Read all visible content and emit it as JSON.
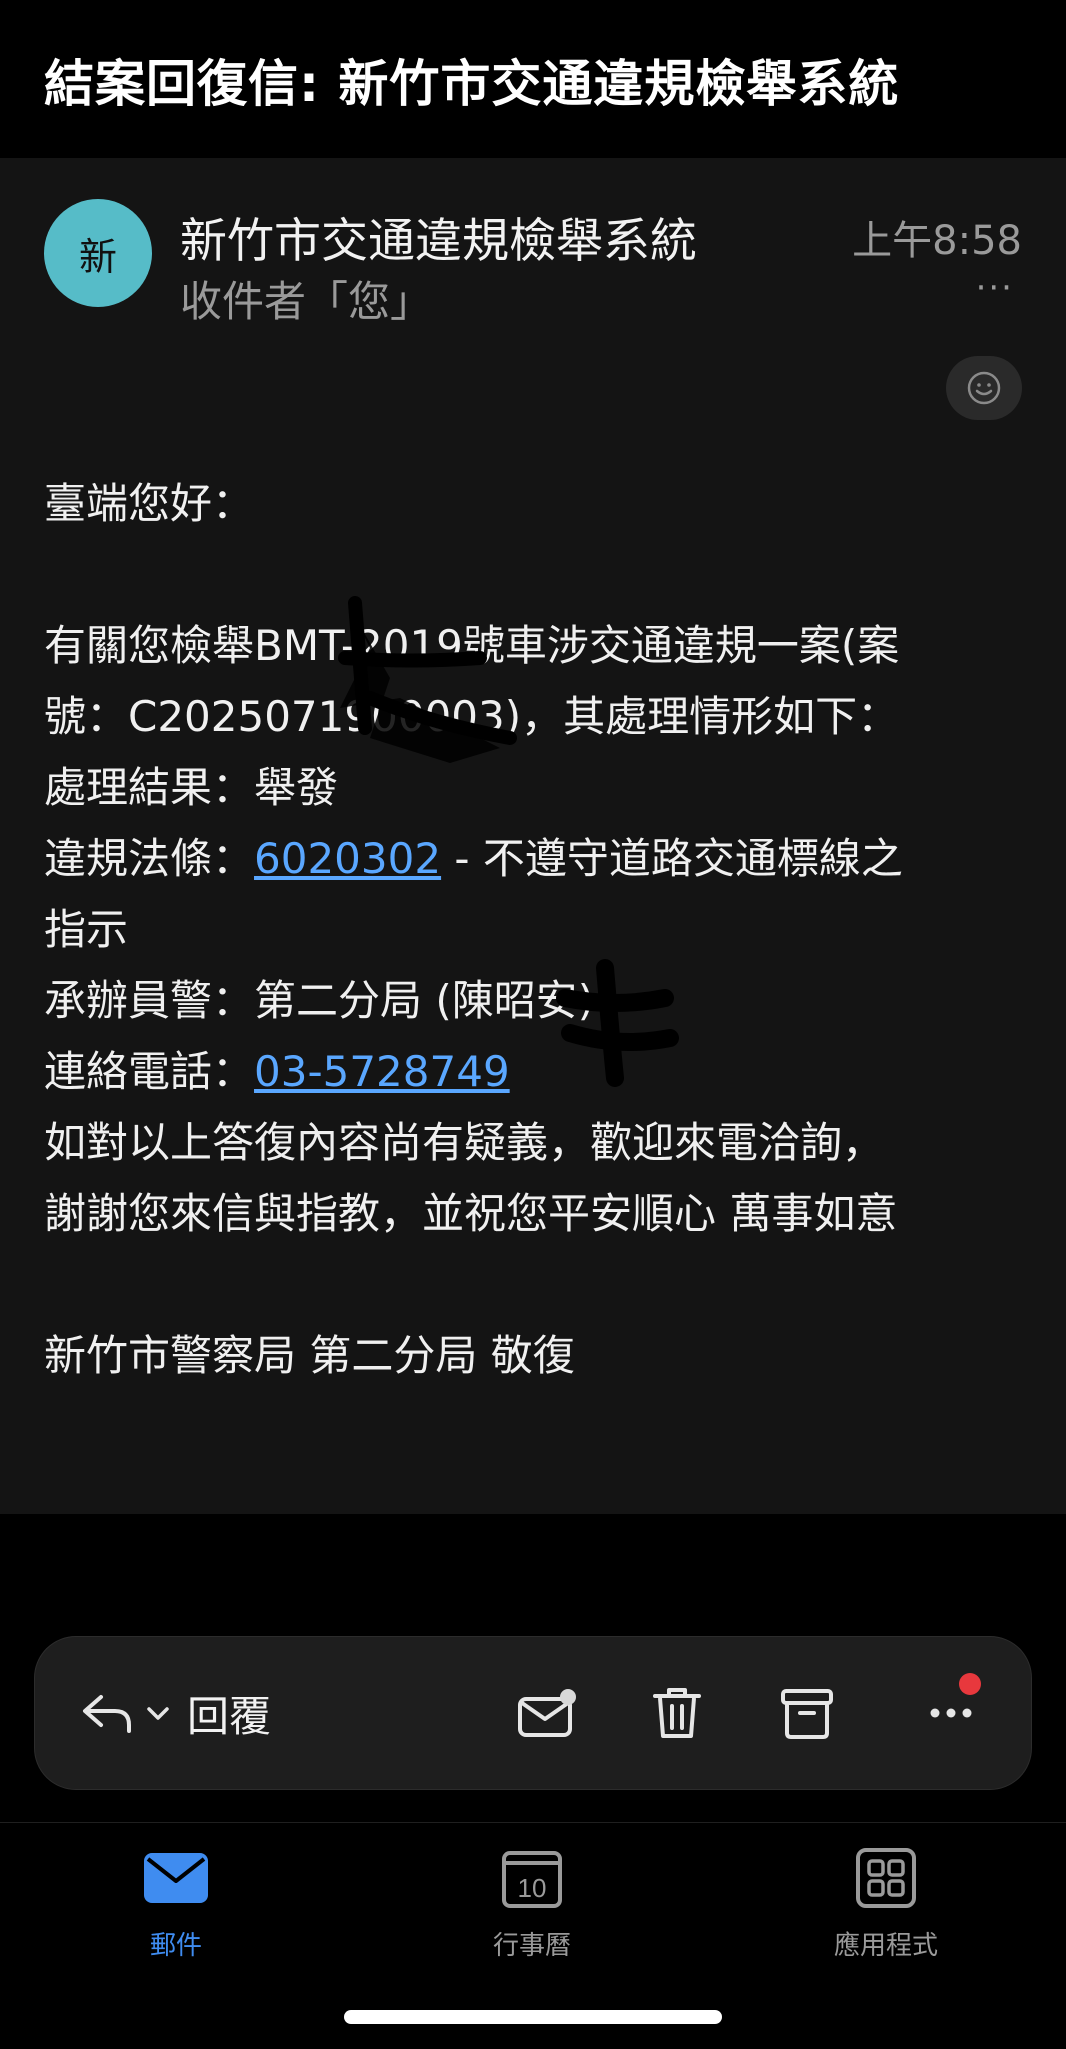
{
  "header": {
    "subject": "結案回復信: 新竹市交通違規檢舉系統"
  },
  "email": {
    "avatar_letter": "新",
    "sender": "新竹市交通違規檢舉系統",
    "recipient": "收件者「您」",
    "time": "上午8:58",
    "more": "···",
    "body": {
      "greeting": "臺端您好：",
      "line1": "有關您檢舉BMT-2019號車涉交通違規一案(案",
      "line2": "號：C2025071900003)，其處理情形如下：",
      "result_label": "處理結果：",
      "result_value": "舉發",
      "law_label": "違規法條：",
      "law_code": "6020302",
      "law_desc": " - 不遵守道路交通標線之",
      "law_desc2": "指示",
      "officer_label": "承辦員警：",
      "officer_value": "第二分局 (陳昭安)",
      "phone_label": "連絡電話：",
      "phone_value": "03-5728749",
      "closing1": "如對以上答復內容尚有疑義，歡迎來電洽詢，",
      "closing2": "謝謝您來信與指教，並祝您平安順心 萬事如意",
      "signature": "新竹市警察局 第二分局 敬復"
    }
  },
  "actions": {
    "reply_label": "回覆"
  },
  "tabs": [
    {
      "label": "郵件",
      "active": true,
      "icon": "mail-icon"
    },
    {
      "label": "行事曆",
      "active": false,
      "icon": "calendar-icon",
      "day": "10"
    },
    {
      "label": "應用程式",
      "active": false,
      "icon": "apps-icon"
    }
  ],
  "colors": {
    "accent": "#3f8cf0",
    "link": "#5aa7ff",
    "avatar": "#56bcc8",
    "badge": "#e8383d"
  }
}
